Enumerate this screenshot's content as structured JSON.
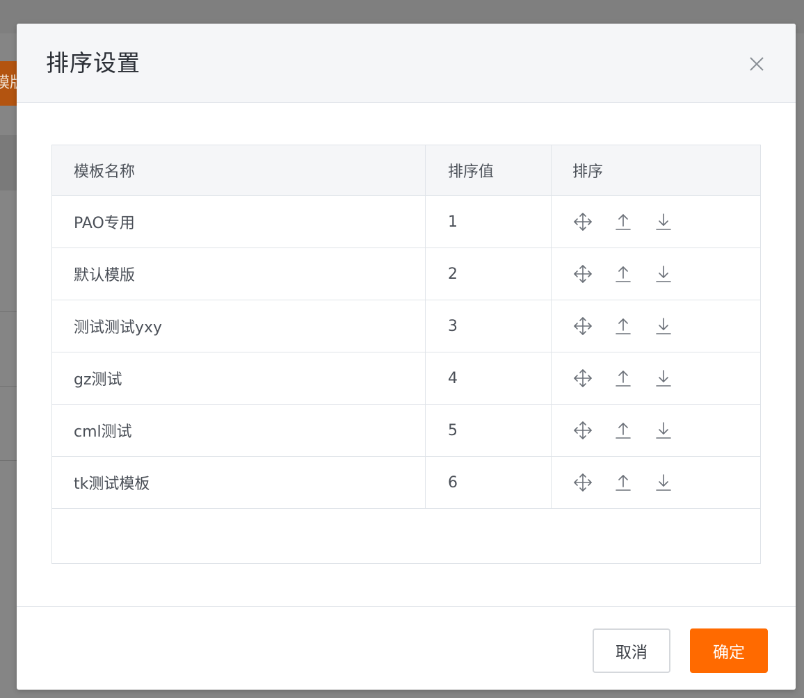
{
  "background": {
    "partial_button_text": "模版"
  },
  "dialog": {
    "title": "排序设置",
    "close_icon": "close-icon"
  },
  "table": {
    "columns": [
      "模板名称",
      "排序值",
      "排序"
    ],
    "rows": [
      {
        "name": "PAO专用",
        "value": "1"
      },
      {
        "name": "默认模版",
        "value": "2"
      },
      {
        "name": "测试测试yxy",
        "value": "3"
      },
      {
        "name": "gz测试",
        "value": "4"
      },
      {
        "name": "cml测试",
        "value": "5"
      },
      {
        "name": "tk测试模板",
        "value": "6"
      }
    ],
    "row_actions": [
      "move-icon",
      "arrow-up-icon",
      "arrow-down-icon"
    ]
  },
  "footer": {
    "cancel_label": "取消",
    "confirm_label": "确定"
  },
  "colors": {
    "accent": "#ff6a00",
    "header_bg": "#f5f6f8",
    "border": "#dfe3e8",
    "overlay": "#7f7f7f"
  }
}
